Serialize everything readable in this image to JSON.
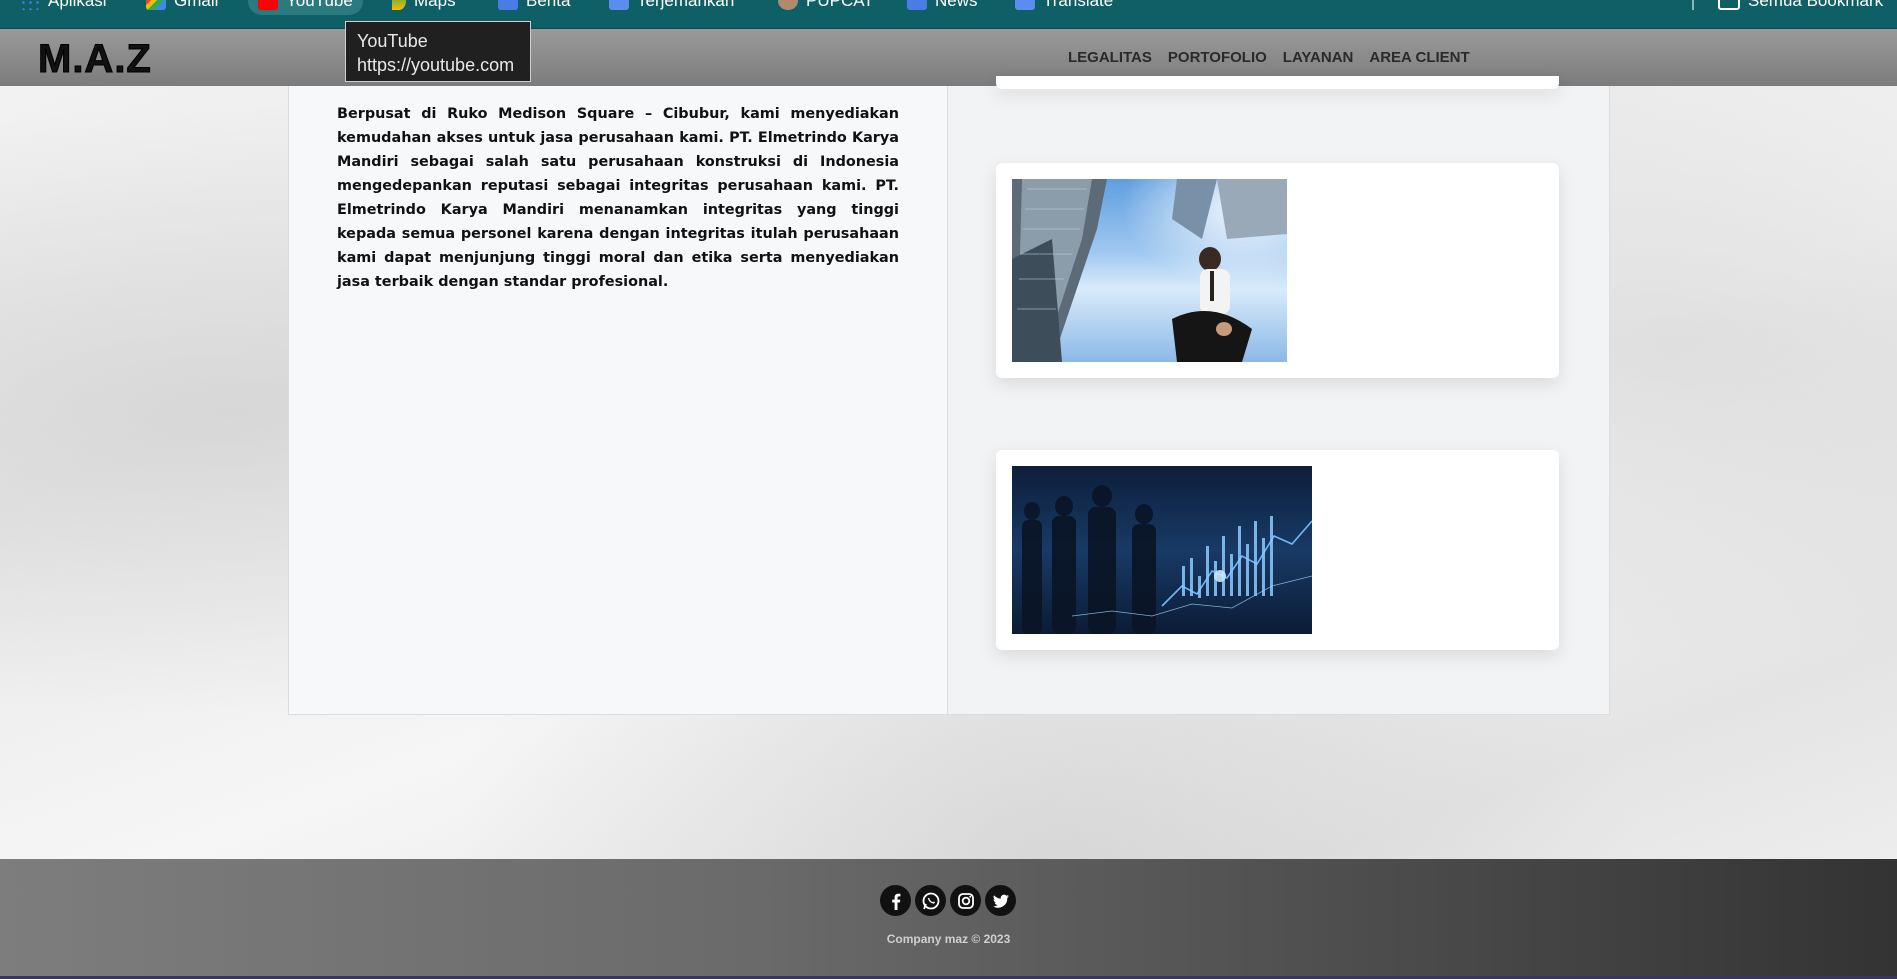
{
  "bookmarks": {
    "items": [
      {
        "label": "Aplikasi",
        "icon": "apps-grid-icon"
      },
      {
        "label": "Gmail",
        "icon": "gmail-icon"
      },
      {
        "label": "YouTube",
        "icon": "youtube-icon"
      },
      {
        "label": "Maps",
        "icon": "maps-icon"
      },
      {
        "label": "Berita",
        "icon": "news-icon"
      },
      {
        "label": "Terjemahkan",
        "icon": "translate-icon"
      },
      {
        "label": "PUPCAT",
        "icon": "cat-icon"
      },
      {
        "label": "News",
        "icon": "news-icon"
      },
      {
        "label": "Translate",
        "icon": "translate-icon"
      }
    ],
    "all_bookmarks": "Semua Bookmark"
  },
  "tooltip": {
    "title": "YouTube",
    "url": "https://youtube.com"
  },
  "navbar": {
    "logo": "M.A.Z",
    "links": [
      "LEGALITAS",
      "PORTOFOLIO",
      "LAYANAN",
      "AREA CLIENT"
    ]
  },
  "main": {
    "about_text": "Berpusat di Ruko Medison Square – Cibubur, kami menyediakan kemudahan akses untuk jasa perusahaan kami. PT. Elmetrindo Karya Mandiri sebagai salah satu perusahaan konstruksi di Indonesia mengedepankan reputasi sebagai integritas perusahaan kami. PT. Elmetrindo Karya Mandiri menanamkan integritas yang tinggi kepada semua personel karena dengan integritas itulah perusahaan kami dapat menjunjung tinggi moral dan etika serta menyediakan jasa terbaik dengan standar profesional."
  },
  "footer": {
    "social": [
      "facebook-icon",
      "whatsapp-icon",
      "instagram-icon",
      "twitter-icon"
    ],
    "copyright": "Company maz © 2023"
  },
  "colors": {
    "bookmarks_bar": "#0e5f66",
    "navbar": "#8a8a8a",
    "footer": "#5a5a5a"
  }
}
